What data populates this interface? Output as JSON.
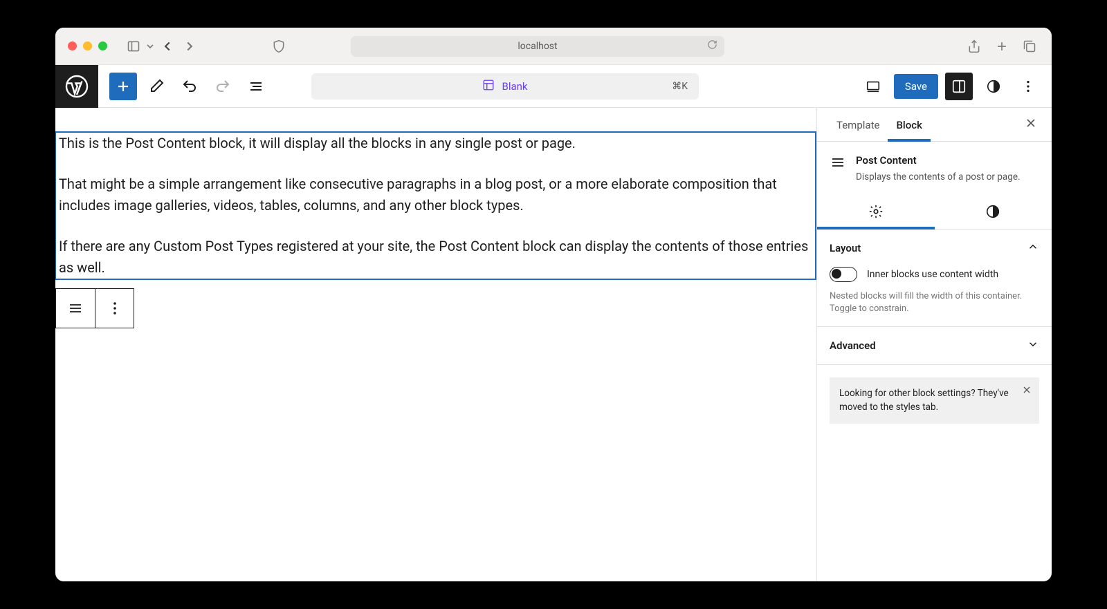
{
  "browser": {
    "url": "localhost"
  },
  "toolbar": {
    "doc_title": "Blank",
    "shortcut": "⌘K",
    "save_label": "Save"
  },
  "content": {
    "p1": "This is the Post Content block, it will display all the blocks in any single post or page.",
    "p2": "That might be a simple arrangement like consecutive paragraphs in a blog post, or a more elaborate composition that includes image galleries, videos, tables, columns, and any other block types.",
    "p3": "If there are any Custom Post Types registered at your site, the Post Content block can display the contents of those entries as well."
  },
  "sidebar": {
    "tab_template": "Template",
    "tab_block": "Block",
    "block_title": "Post Content",
    "block_desc": "Displays the contents of a post or page.",
    "layout_label": "Layout",
    "toggle_label": "Inner blocks use content width",
    "toggle_hint": "Nested blocks will fill the width of this container. Toggle to constrain.",
    "advanced_label": "Advanced",
    "notice_text": "Looking for other block settings? They've moved to the styles tab."
  }
}
